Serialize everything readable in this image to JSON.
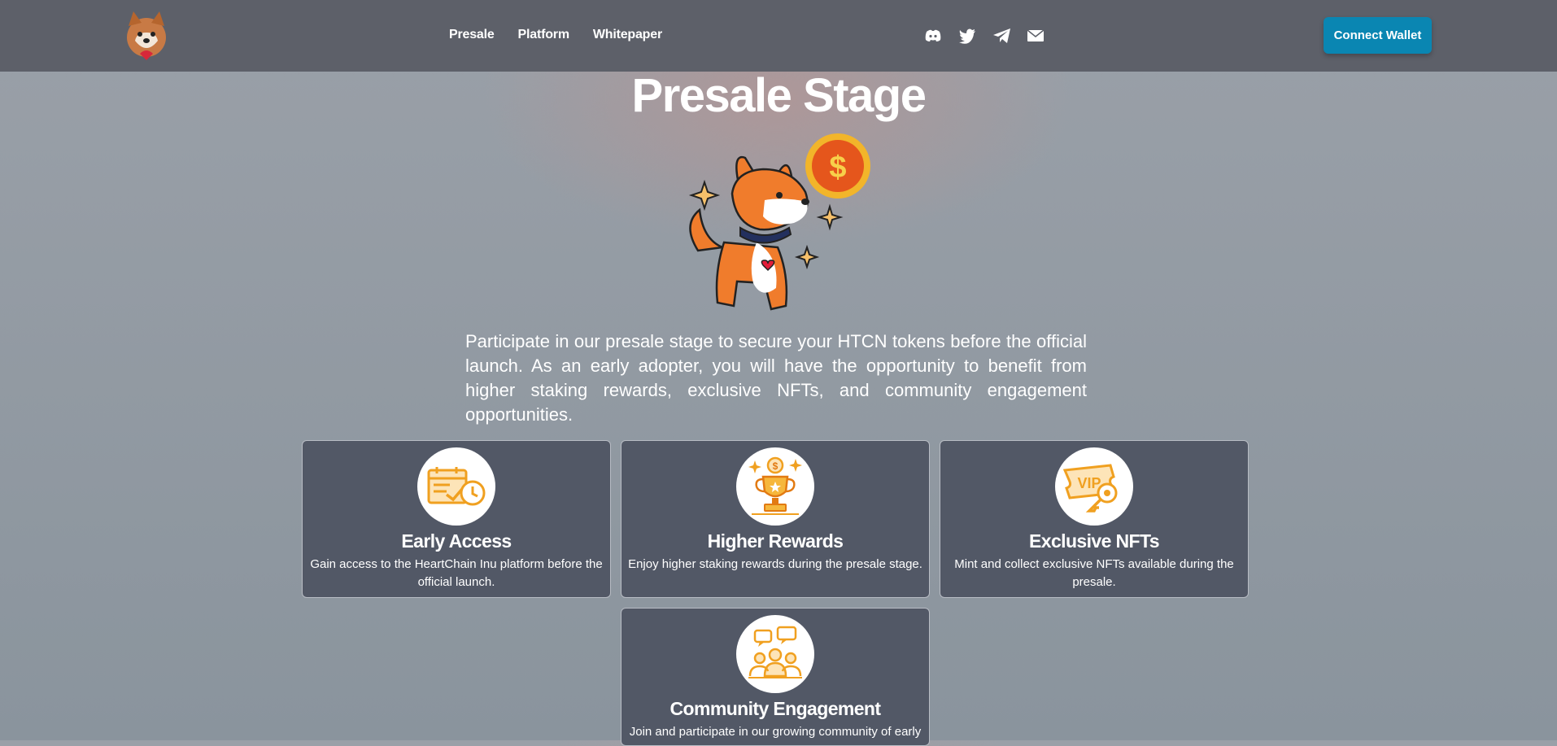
{
  "nav": {
    "logo_icon": "shiba-dog-heart-logo",
    "links": [
      "Presale",
      "Platform",
      "Whitepaper"
    ],
    "social_icons": [
      "discord-icon",
      "twitter-icon",
      "telegram-icon",
      "email-icon"
    ],
    "connect_label": "Connect Wallet"
  },
  "hero": {
    "title": "Presale Stage",
    "image": "shiba-coin-illustration",
    "intro": "Participate in our presale stage to secure your HTCN tokens before the official launch. As an early adopter, you will have the opportunity to benefit from higher staking rewards, exclusive NFTs, and community engagement opportunities."
  },
  "cards": [
    {
      "icon": "calendar-clock-icon",
      "title": "Early Access",
      "text": "Gain access to the HeartChain Inu platform before the official launch."
    },
    {
      "icon": "trophy-icon",
      "title": "Higher Rewards",
      "text": "Enjoy higher staking rewards during the presale stage."
    },
    {
      "icon": "vip-ticket-icon",
      "title": "Exclusive NFTs",
      "text": "Mint and collect exclusive NFTs available during the presale."
    },
    {
      "icon": "community-icon",
      "title": "Community Engagement",
      "text": "Join and participate in our growing community of early"
    }
  ],
  "colors": {
    "topbar": "#5d6069",
    "accent": "#0a86b2",
    "card": "#525866",
    "icon_orange": "#f0a020"
  }
}
